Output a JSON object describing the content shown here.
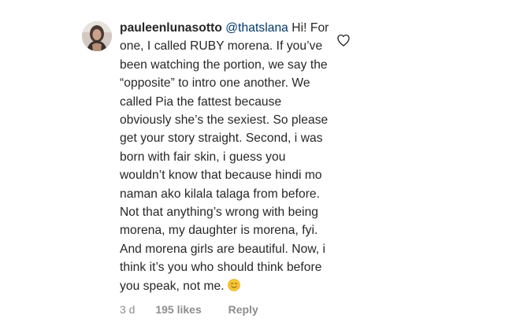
{
  "comment": {
    "avatar_icon": "profile-photo",
    "username": "pauleenlunasotto",
    "mention": "@thatslana",
    "text": "Hi! For one, I called RUBY morena. If you’ve been watching the portion, we say the “opposite” to intro one another. We called Pia the fattest because obviously she’s the sexiest. So please get your story straight. Second, i was born with fair skin, i guess you wouldn’t know that because hindi mo naman ako kilala talaga from before. Not that anything’s wrong with being morena, my daughter is morena, fyi. And morena girls are beautiful. Now, i think it’s you who should think before you speak, not me.",
    "emoji": "smiling-face-emoji",
    "like_icon": "heart-outline-icon",
    "time": "3 d",
    "likes": "195 likes",
    "reply_label": "Reply"
  },
  "colors": {
    "text": "#262626",
    "mention": "#00376b",
    "meta": "#8e8e8e",
    "background": "#ffffff"
  }
}
